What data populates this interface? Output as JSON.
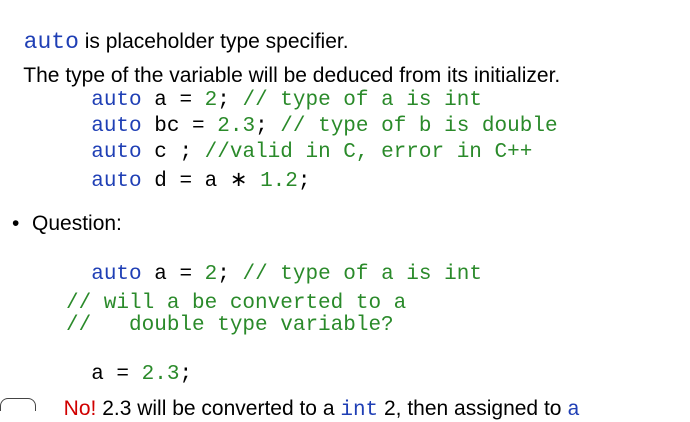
{
  "line1": {
    "kw": "auto",
    "text": " is placeholder type specifier."
  },
  "line2": {
    "text": "The type of the variable will be deduced from its initializer."
  },
  "code1": [
    {
      "kw": "auto",
      "pre": " a = ",
      "num": "2",
      "post": "; ",
      "cmt": "// type of a is int"
    },
    {
      "kw": "auto",
      "pre": " bc = ",
      "num": "2.3",
      "post": "; ",
      "cmt": "// type of b is double"
    },
    {
      "kw": "auto",
      "pre": " c ; ",
      "num": "",
      "post": "",
      "cmt": "//valid in C, error in C++"
    },
    {
      "kw": "auto",
      "pre": " d = a ∗ ",
      "num": "1.2",
      "post": ";",
      "cmt": ""
    }
  ],
  "question": {
    "bullet": "•",
    "label": "Question:"
  },
  "code2": {
    "kw": "auto",
    "pre": " a = ",
    "num": "2",
    "post": "; ",
    "cmt": "// type of a is int"
  },
  "comment_block": [
    "// will a be converted to a",
    "//   double type variable?"
  ],
  "assign": {
    "pre": "a = ",
    "num": "2.3",
    "post": ";"
  },
  "answer": {
    "no": "No!",
    "text1": " 2.3 will be converted to a ",
    "int_kw": "int",
    "text2": " 2, then assigned to ",
    "a_kw": "a"
  }
}
